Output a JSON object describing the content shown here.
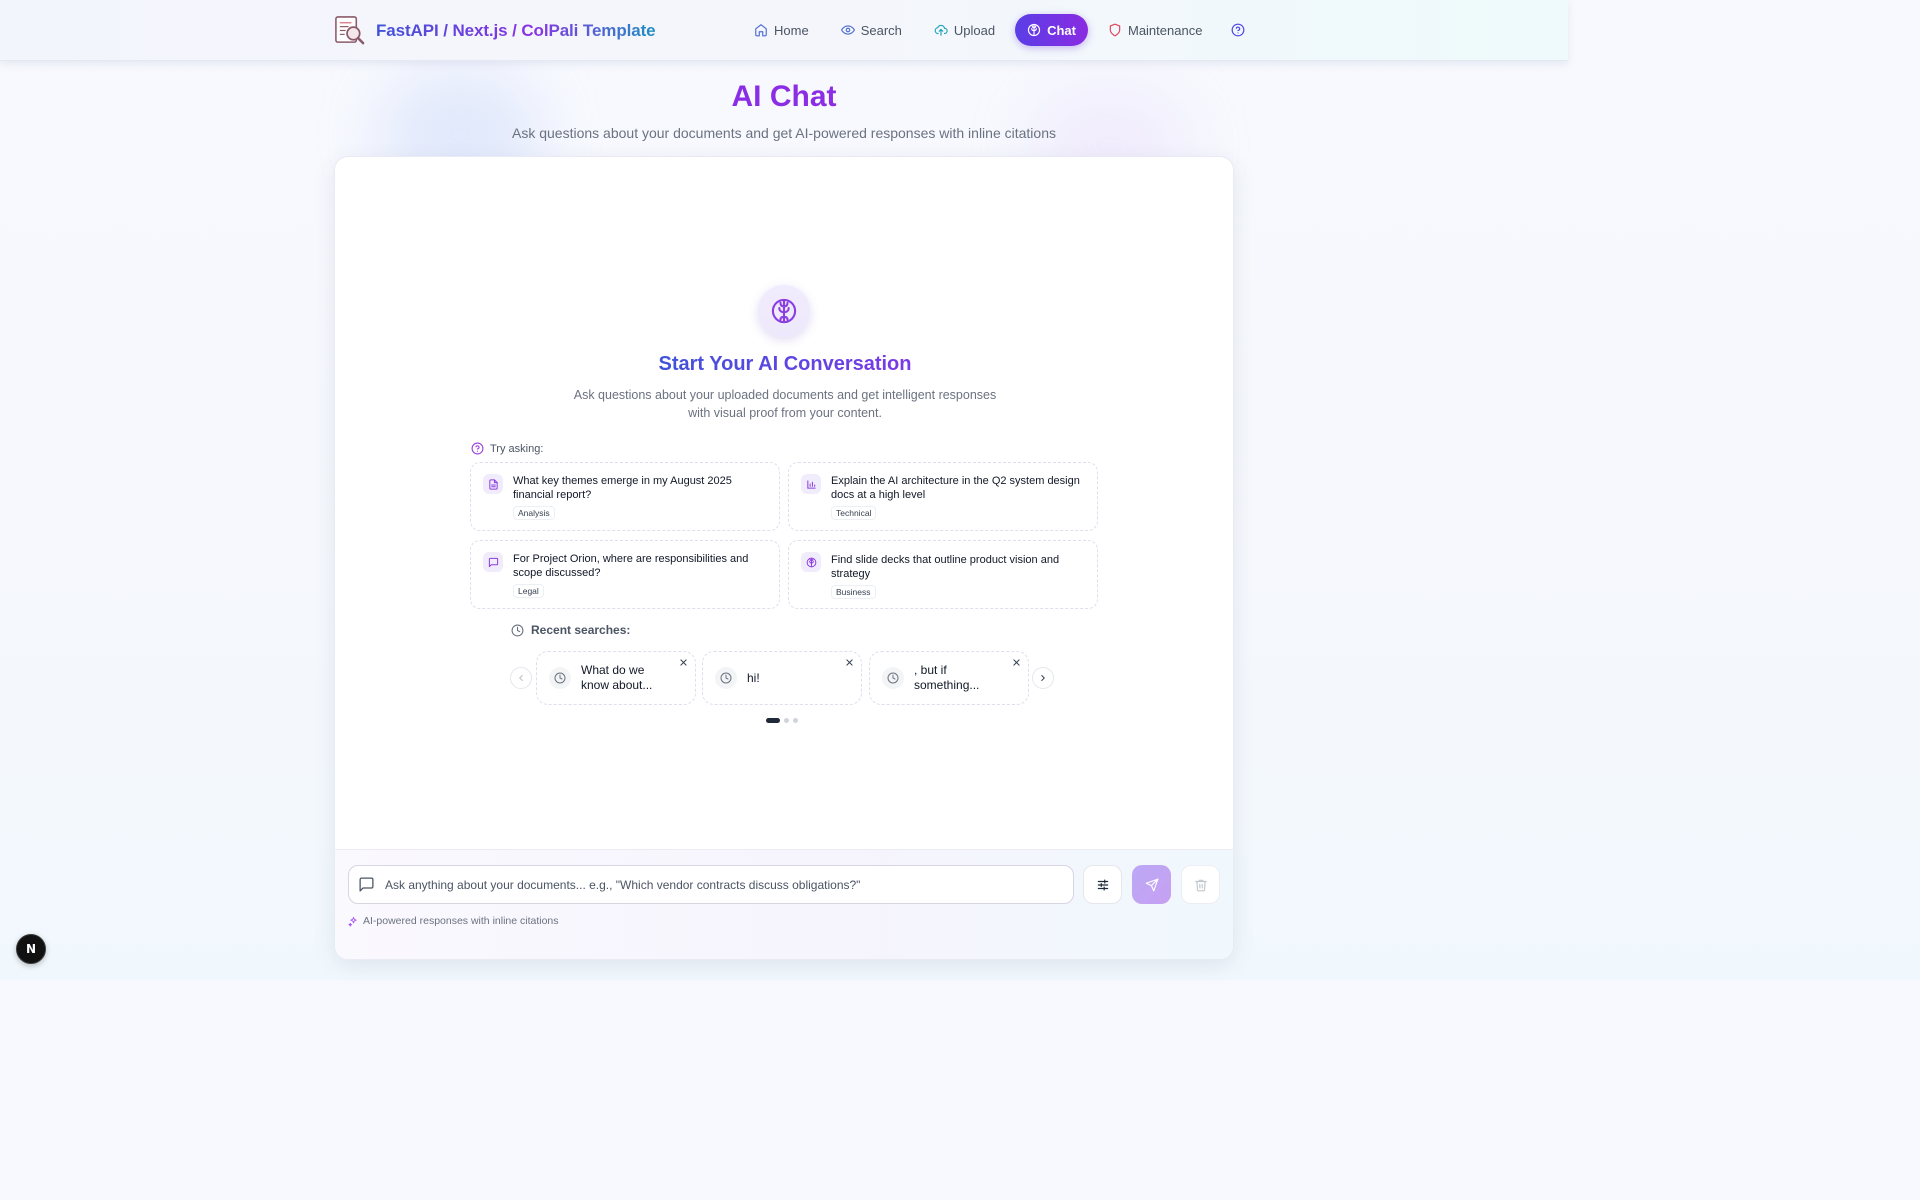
{
  "colors": {
    "accent": "#7b2ff2",
    "accent_indigo": "#4f46e5",
    "brand_gradient": [
      "#3f53d9",
      "#8b32e3",
      "#1f8fc2"
    ],
    "home_icon": "#4f6ed1",
    "search_icon": "#4f6ed1",
    "upload_icon": "#22a3b8",
    "maintenance_icon": "#e0455b",
    "help_icon": "#4f46e5"
  },
  "header": {
    "logo_icon": "document-magnifier-logo",
    "title": "FastAPI / Next.js / ColPali Template",
    "nav": [
      {
        "label": "Home",
        "icon": "home-icon",
        "active": false
      },
      {
        "label": "Search",
        "icon": "eye-icon",
        "active": false
      },
      {
        "label": "Upload",
        "icon": "cloud-upload-icon",
        "active": false
      },
      {
        "label": "Chat",
        "icon": "brain-icon",
        "active": true
      },
      {
        "label": "Maintenance",
        "icon": "shield-icon",
        "active": false
      }
    ],
    "help_icon": "help-circle-icon"
  },
  "hero": {
    "title": "AI Chat",
    "subtitle": "Ask questions about your documents and get AI-powered responses with inline citations"
  },
  "empty_state": {
    "icon": "brain-icon",
    "title": "Start Your AI Conversation",
    "description": "Ask questions about your uploaded documents and get intelligent responses with visual proof from your content.",
    "try_label": "Try asking:"
  },
  "suggestions": [
    {
      "text": "What key themes emerge in my August 2025 financial report?",
      "tag": "Analysis",
      "icon": "file-text-icon"
    },
    {
      "text": "Explain the AI architecture in the Q2 system design docs at a high level",
      "tag": "Technical",
      "icon": "bar-chart-icon"
    },
    {
      "text": "For Project Orion, where are responsibilities and scope discussed?",
      "tag": "Legal",
      "icon": "message-square-icon"
    },
    {
      "text": "Find slide decks that outline product vision and strategy",
      "tag": "Business",
      "icon": "brain-icon"
    }
  ],
  "recent": {
    "label": "Recent searches:",
    "items": [
      {
        "text": "What do we know about..."
      },
      {
        "text": "hi!"
      },
      {
        "text": ", but if something..."
      }
    ],
    "page_count": 3,
    "current_page": 1
  },
  "composer": {
    "placeholder": "Ask anything about your documents... e.g., \"Which vendor contracts discuss obligations?\"",
    "value": "",
    "note": "AI-powered responses with inline citations"
  },
  "dev_badge": "N"
}
